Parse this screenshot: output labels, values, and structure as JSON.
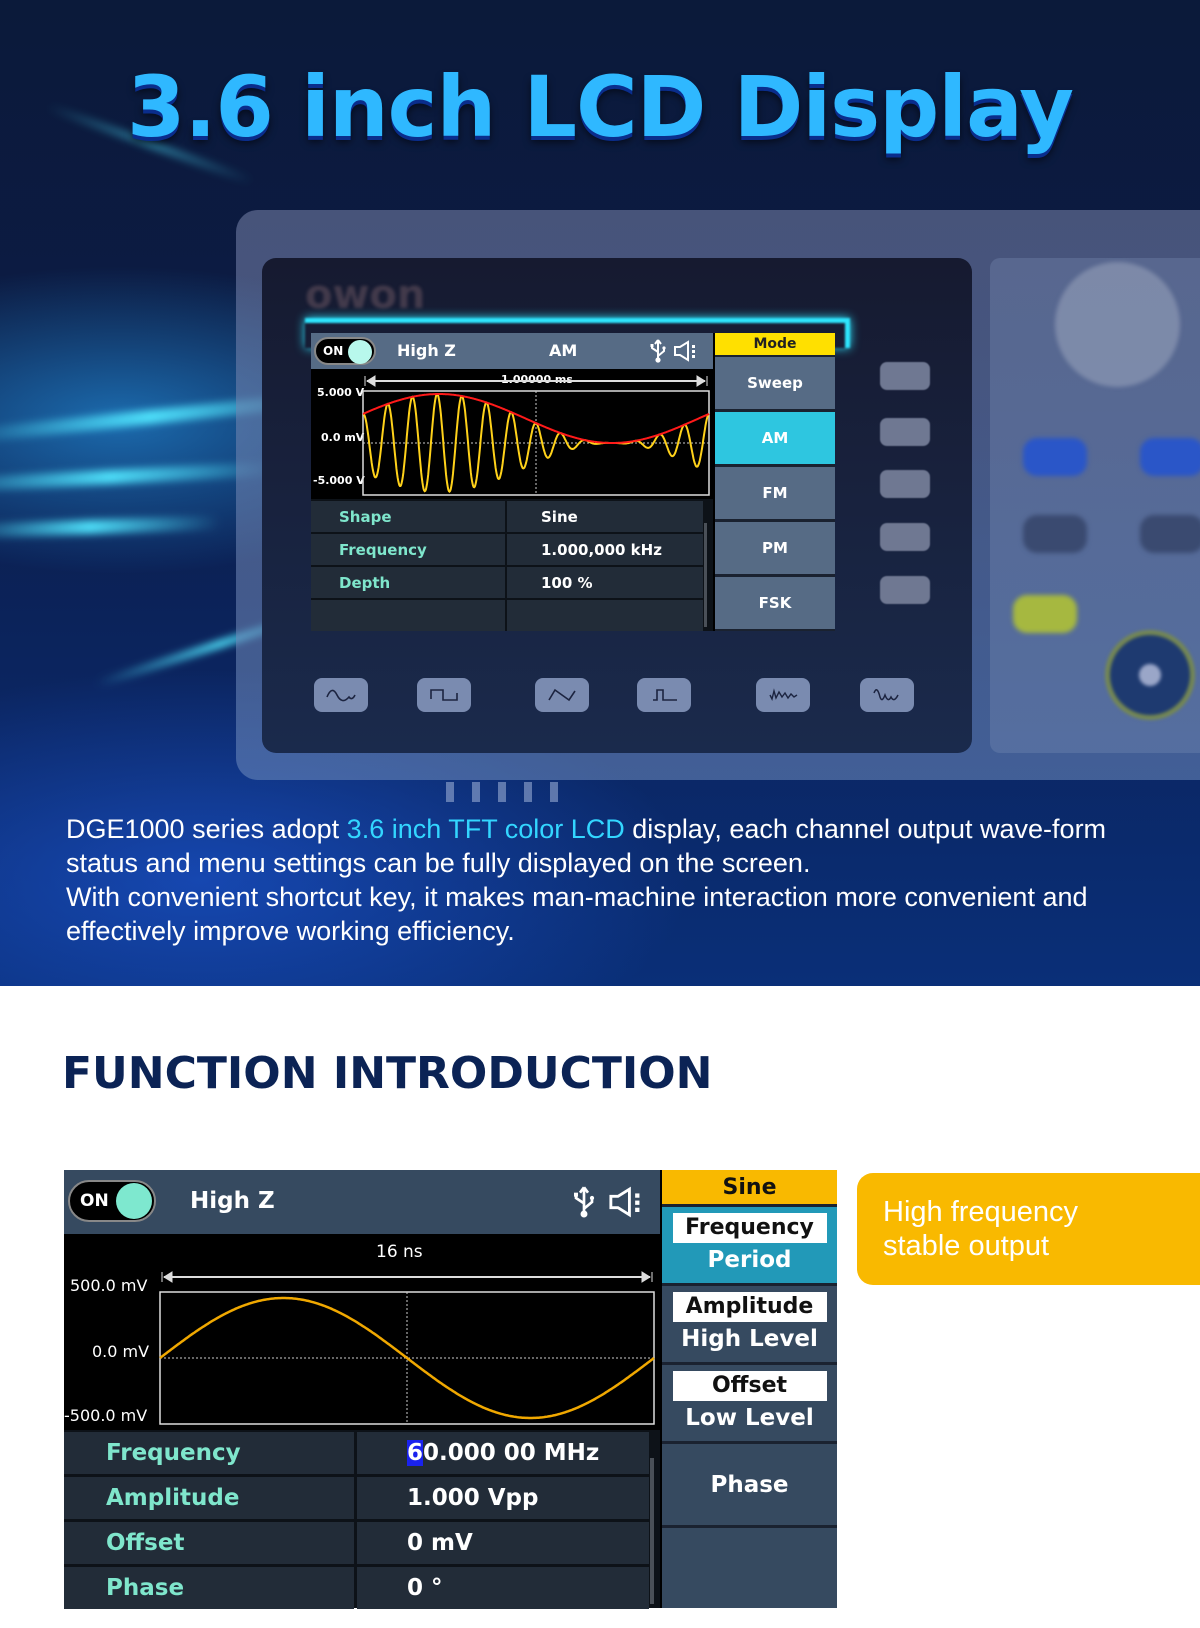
{
  "banner": {
    "title": "3.6 inch LCD Display",
    "brand": "owon",
    "description": {
      "part1": "DGE1000 series adopt ",
      "highlight": "3.6 inch TFT color LCD",
      "part2": " display, each channel output wave-form status and menu settings can be fully displayed on the screen.",
      "line2": "With convenient shortcut key, it makes man-machine interaction more convenient and effectively improve working efficiency."
    },
    "wave_keys": [
      "sine-icon",
      "square-icon",
      "ramp-icon",
      "pulse-icon",
      "noise-icon",
      "arbitrary-icon"
    ]
  },
  "lcd1": {
    "toggle": "ON",
    "load": "High Z",
    "mode": "AM",
    "time_span": "1.00000 ms",
    "y_labels": {
      "top": "5.000 V",
      "mid": "0.0 mV",
      "bottom": "-5.000 V"
    },
    "params": [
      {
        "key": "Shape",
        "value": "Sine"
      },
      {
        "key": "Frequency",
        "value": "1.000,000 kHz"
      },
      {
        "key": "Depth",
        "value": "100 %"
      },
      {
        "key": "",
        "value": ""
      }
    ],
    "menu_title": "Mode",
    "menu": [
      "Sweep",
      "AM",
      "FM",
      "PM",
      "FSK"
    ],
    "menu_active": "AM",
    "colors": {
      "carrier": "#ffd21a",
      "envelope": "#ff1a1a",
      "active": "#2ec6e0",
      "title": "#ffe000"
    },
    "chart_data": {
      "type": "line",
      "series": [
        {
          "name": "AM carrier",
          "modulation_depth_pct": 100,
          "cycles": 14,
          "envelope_cycles": 1
        },
        {
          "name": "envelope"
        }
      ],
      "ylim": [
        -5,
        5
      ],
      "yunit": "V",
      "x_span": "1.00000 ms"
    }
  },
  "lcd2": {
    "toggle": "ON",
    "load": "High Z",
    "time_span": "16 ns",
    "y_labels": {
      "top": "500.0 mV",
      "mid": "0.0 mV",
      "bottom": "-500.0 mV"
    },
    "params": [
      {
        "key": "Frequency",
        "value_cursor": "6",
        "value": "0.000 00 MHz"
      },
      {
        "key": "Amplitude",
        "value": "1.000 Vpp"
      },
      {
        "key": "Offset",
        "value": "0 mV"
      },
      {
        "key": "Phase",
        "value": "0 °"
      }
    ],
    "menu_title": "Sine",
    "menu": [
      {
        "selected": "Frequency",
        "alt": "Period",
        "active": true
      },
      {
        "selected": "Amplitude",
        "alt": "High Level"
      },
      {
        "selected": "Offset",
        "alt": "Low Level"
      },
      {
        "selected": "Phase"
      },
      {
        "selected": ""
      }
    ],
    "colors": {
      "wave": "#f0a800",
      "title": "#f9b900",
      "active": "#2299b8"
    },
    "chart_data": {
      "type": "line",
      "series": [
        {
          "name": "sine",
          "frequency": "60 MHz",
          "amplitude_vpp": 1.0,
          "offset_mv": 0,
          "phase_deg": 0,
          "cycles": 1
        }
      ],
      "ylim": [
        -0.5,
        0.5
      ],
      "yunit": "V",
      "x_span": "16 ns"
    }
  },
  "section": {
    "title": "FUNCTION INTRODUCTION"
  },
  "callout": {
    "line1": "High frequency",
    "line2": "stable output"
  }
}
